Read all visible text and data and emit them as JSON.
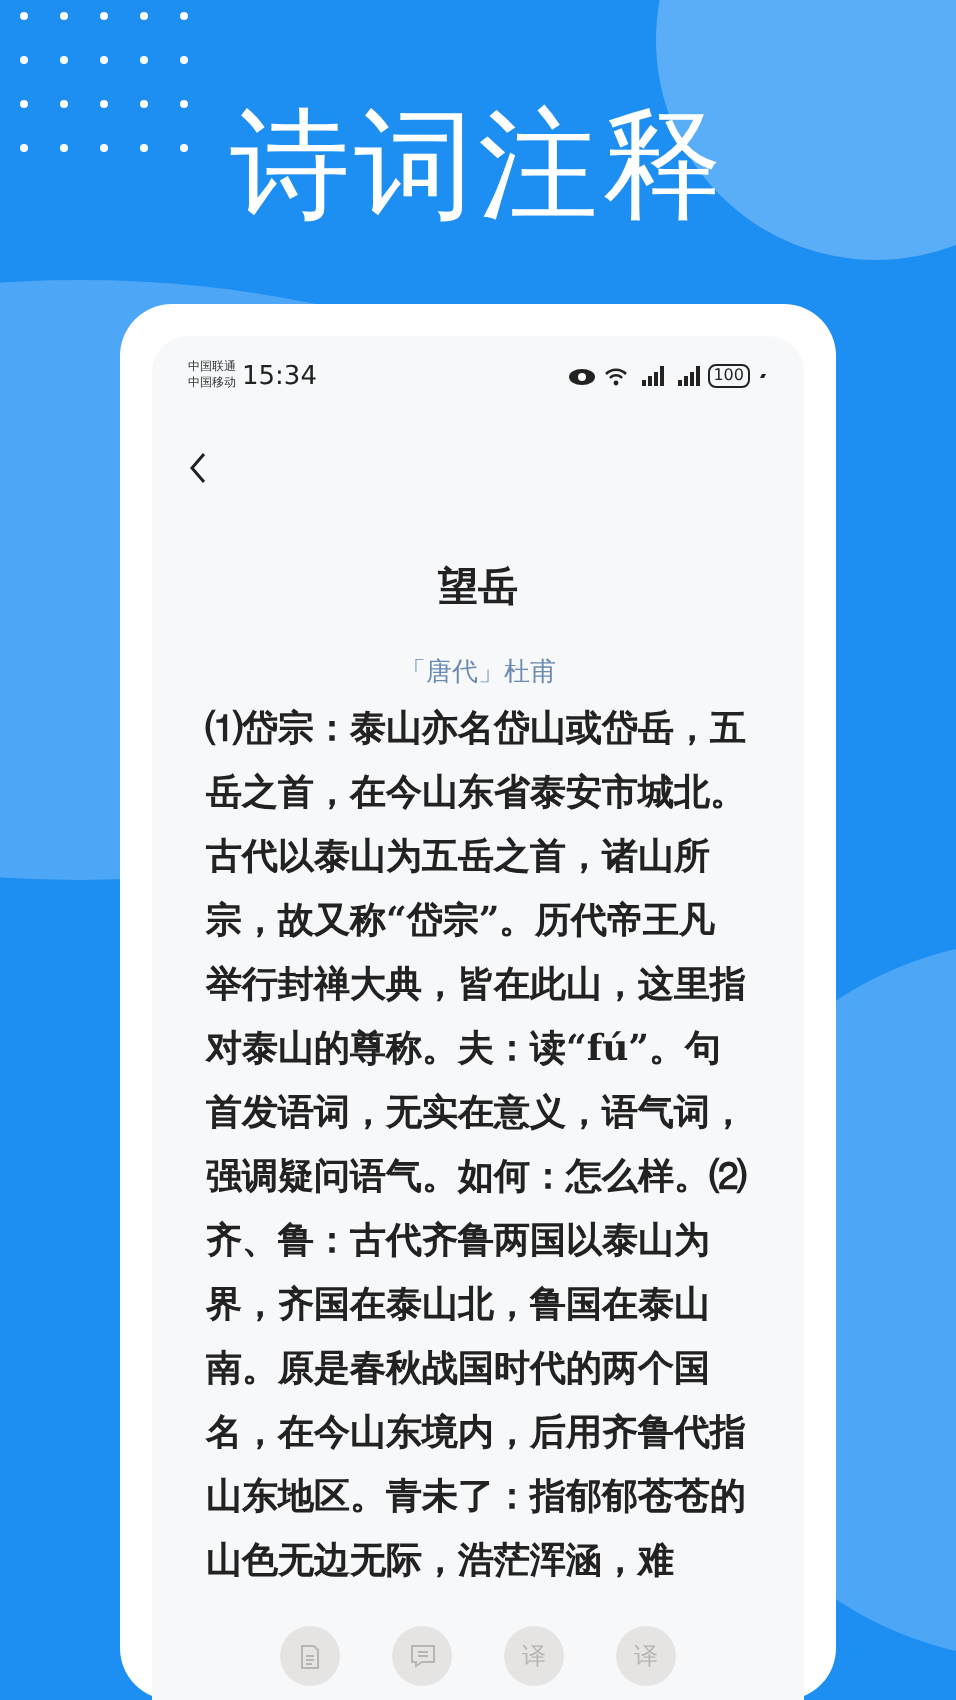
{
  "headline": "诗词注释",
  "status_bar": {
    "carriers": [
      "中国联通",
      "中国移动"
    ],
    "time": "15:34",
    "battery": "100"
  },
  "poem": {
    "title": "望岳",
    "dynasty": "「唐代」",
    "author": "杜甫",
    "annotation": "⑴岱宗：泰山亦名岱山或岱岳，五岳之首，在今山东省泰安市城北。古代以泰山为五岳之首，诸山所宗，故又称“岱宗”。历代帝王凡举行封禅大典，皆在此山，这里指对泰山的尊称。夫：读“fú”。句首发语词，无实在意义，语气词，强调疑问语气。如何：怎么样。⑵齐、鲁：古代齐鲁两国以泰山为界，齐国在泰山北，鲁国在泰山南。原是春秋战国时代的两个国名，在今山东境内，后用齐鲁代指山东地区。青未了：指郁郁苍苍的山色无边无际，浩茫浑涵，难"
  },
  "toolbar": [
    {
      "kind": "document"
    },
    {
      "kind": "comment"
    },
    {
      "kind": "glyph",
      "text": "译"
    },
    {
      "kind": "glyph",
      "text": "译"
    }
  ]
}
